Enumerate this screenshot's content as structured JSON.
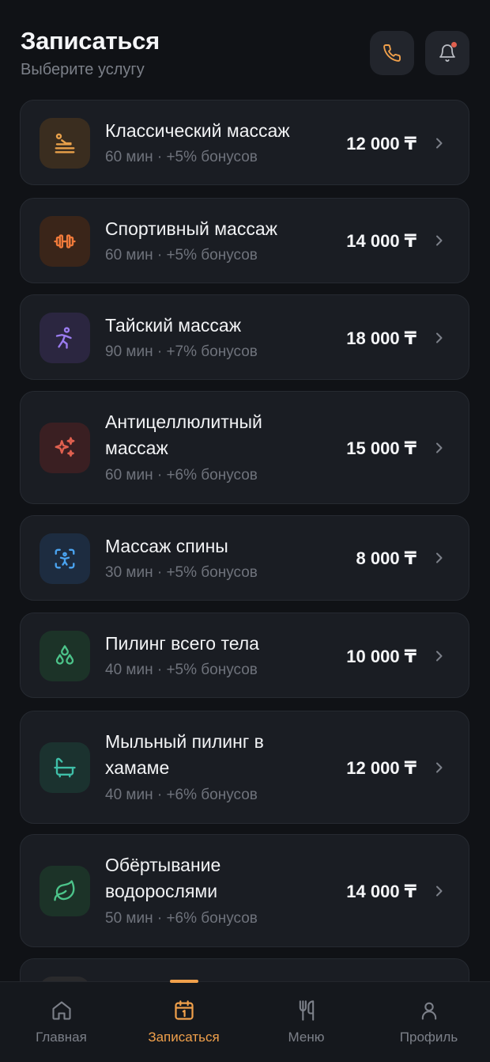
{
  "header": {
    "title": "Записаться",
    "subtitle": "Выберите услугу"
  },
  "services": [
    {
      "name": "Классический массаж",
      "meta": "60 мин · +5% бонусов",
      "price": "12 000 ₸",
      "icon": "massage-icon",
      "color": "#e8a04a"
    },
    {
      "name": "Спортивный массаж",
      "meta": "60 мин · +5% бонусов",
      "price": "14 000 ₸",
      "icon": "dumbbell-icon",
      "color": "#f07a3a"
    },
    {
      "name": "Тайский массаж",
      "meta": "90 мин · +7% бонусов",
      "price": "18 000 ₸",
      "icon": "stretch-person-icon",
      "color": "#9b7cf0"
    },
    {
      "name": "Антицеллюлитный массаж",
      "meta": "60 мин · +6% бонусов",
      "price": "15 000 ₸",
      "icon": "sparkles-icon",
      "color": "#e0604f"
    },
    {
      "name": "Массаж спины",
      "meta": "30 мин · +5% бонусов",
      "price": "8 000 ₸",
      "icon": "body-scan-icon",
      "color": "#4aa3f0"
    },
    {
      "name": "Пилинг всего тела",
      "meta": "40 мин · +5% бонусов",
      "price": "10 000 ₸",
      "icon": "droplets-icon",
      "color": "#4cc48a"
    },
    {
      "name": "Мыльный пилинг в хамаме",
      "meta": "40 мин · +6% бонусов",
      "price": "12 000 ₸",
      "icon": "bathtub-icon",
      "color": "#3fbfa8"
    },
    {
      "name": "Обёртывание водорослями",
      "meta": "50 мин · +6% бонусов",
      "price": "14 000 ₸",
      "icon": "leaf-icon",
      "color": "#4cc48a"
    }
  ],
  "tabbar": {
    "tabs": [
      {
        "label": "Главная",
        "icon": "home-icon",
        "active": false
      },
      {
        "label": "Записаться",
        "icon": "calendar-icon",
        "active": true
      },
      {
        "label": "Меню",
        "icon": "cutlery-icon",
        "active": false
      },
      {
        "label": "Профиль",
        "icon": "user-icon",
        "active": false
      }
    ]
  },
  "colors": {
    "accent": "#f0a04b",
    "background": "#101216",
    "card": "#1a1d23",
    "notification": "#e0604f"
  }
}
